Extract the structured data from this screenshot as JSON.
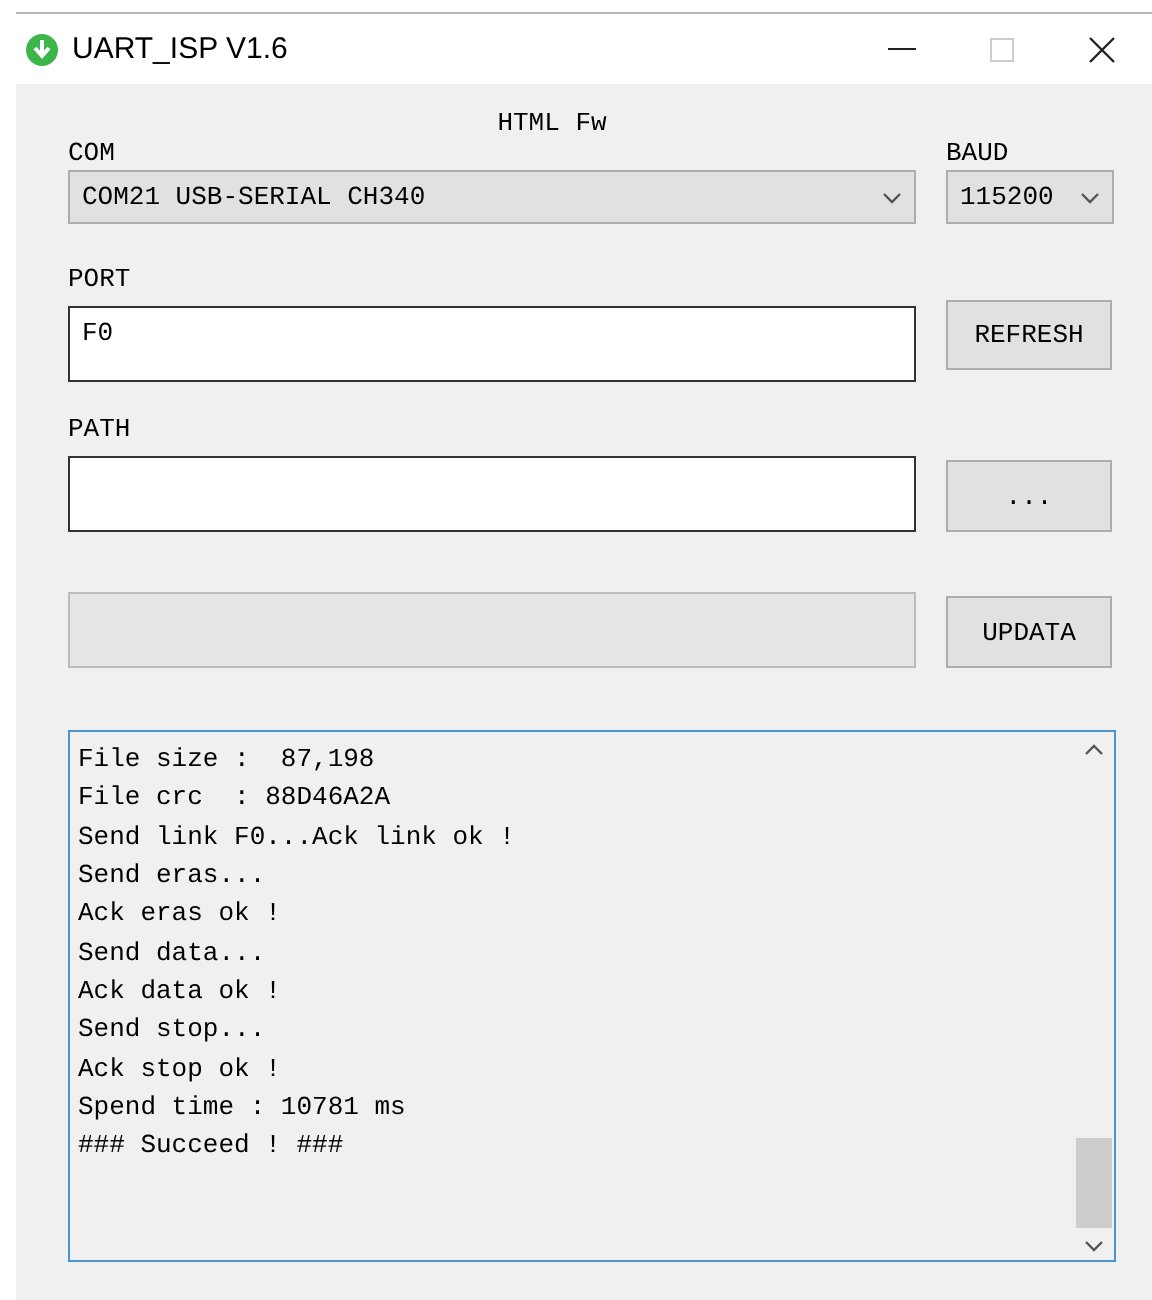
{
  "window": {
    "title": "UART_ISP V1.6"
  },
  "header": "HTML Fw",
  "com": {
    "label": "COM",
    "value": "COM21 USB-SERIAL CH340"
  },
  "baud": {
    "label": "BAUD",
    "value": "115200"
  },
  "port": {
    "label": "PORT",
    "value": "F0"
  },
  "refresh_button": "REFRESH",
  "path": {
    "label": "PATH"
  },
  "browse_button": "...",
  "progress": {
    "level": 0
  },
  "update_button": "UPDATA",
  "log": [
    "File size :  87,198",
    "File crc  : 88D46A2A",
    "Send link F0...Ack link ok !",
    "Send eras...",
    "Ack eras ok !",
    "Send data...",
    "Ack data ok !",
    "Send stop...",
    "Ack stop ok !",
    "Spend time : 10781 ms",
    "### Succeed ! ###"
  ]
}
